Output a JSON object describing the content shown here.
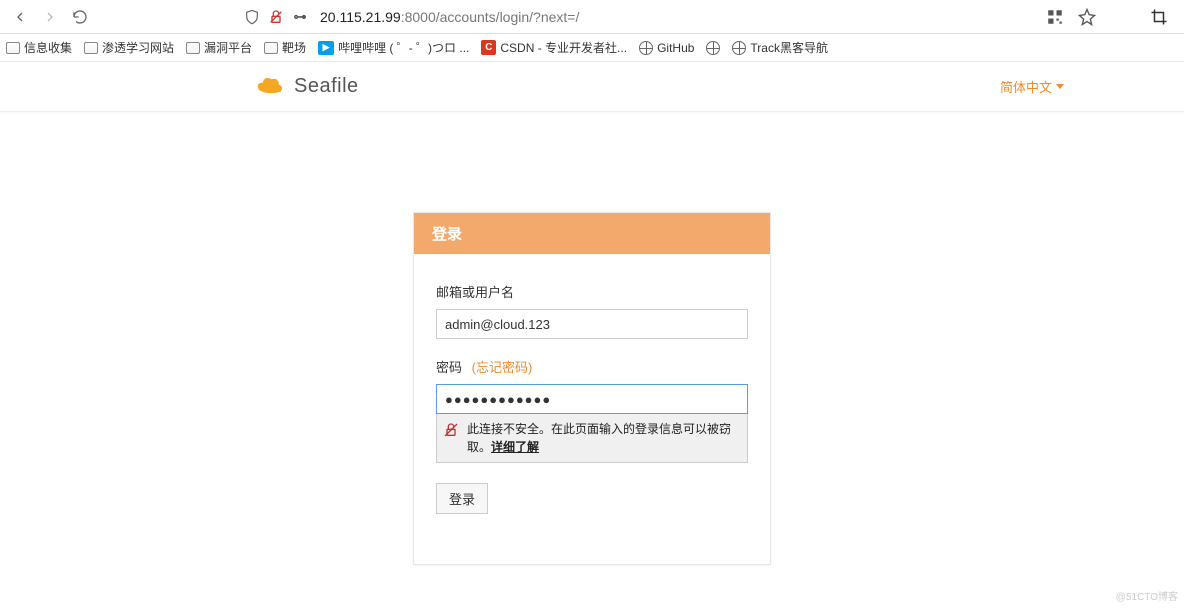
{
  "browser": {
    "url_host": "20.115.21.99",
    "url_port_path": ":8000/accounts/login/?next=/"
  },
  "bookmarks": [
    {
      "type": "folder",
      "label": "信息收集"
    },
    {
      "type": "folder",
      "label": "渗透学习网站"
    },
    {
      "type": "folder",
      "label": "漏洞平台"
    },
    {
      "type": "folder",
      "label": "靶场"
    },
    {
      "type": "bilibili",
      "label": "哔哩哔哩 ( ゜- ゜)つロ ..."
    },
    {
      "type": "csdn",
      "label": "CSDN - 专业开发者社..."
    },
    {
      "type": "globe",
      "label": "GitHub"
    },
    {
      "type": "globe",
      "label": ""
    },
    {
      "type": "globe",
      "label": "Track黑客导航"
    }
  ],
  "header": {
    "brand": "Seafile",
    "language": "简体中文"
  },
  "login": {
    "title": "登录",
    "username_label": "邮箱或用户名",
    "username_value": "admin@cloud.123",
    "password_label": "密码",
    "forgot_label": "(忘记密码)",
    "password_value": "●●●●●●●●●●●●",
    "security_warning": "此连接不安全。在此页面输入的登录信息可以被窃取。",
    "learn_more": "详细了解",
    "submit_label": "登录"
  },
  "watermark": "@51CTO博客"
}
